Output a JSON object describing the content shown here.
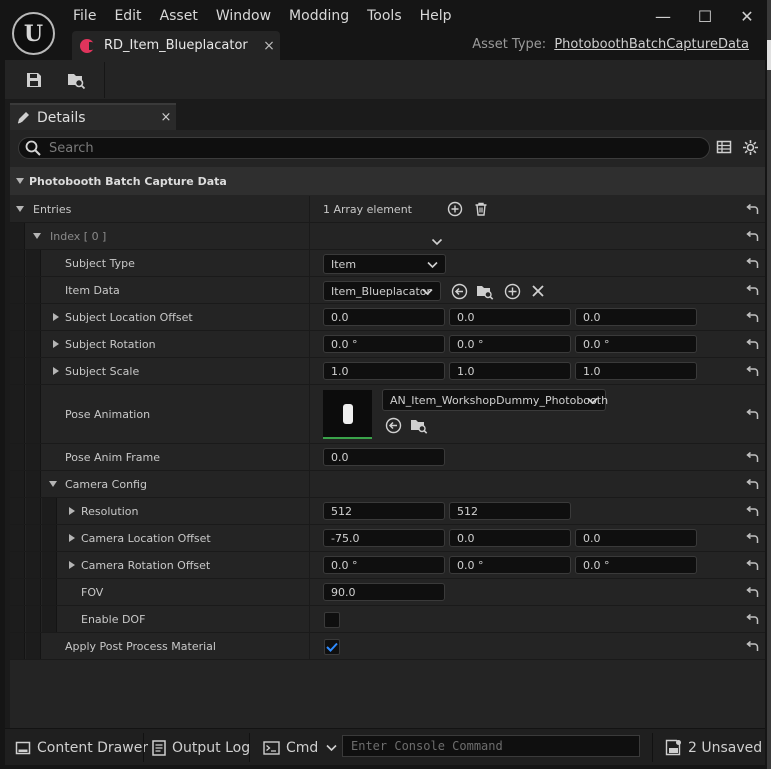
{
  "app": {
    "logo": "U"
  },
  "menu": [
    "File",
    "Edit",
    "Asset",
    "Window",
    "Modding",
    "Tools",
    "Help"
  ],
  "window_controls": {
    "minimize": "—",
    "maximize": "☐",
    "close": "✕"
  },
  "tab": {
    "name": "RD_Item_Blueplacator",
    "close": "×",
    "icon_color": "#e0345c"
  },
  "asset_type": {
    "label": "Asset Type:",
    "value": "PhotoboothBatchCaptureData"
  },
  "details": {
    "tab_label": "Details",
    "tab_close": "×",
    "search_placeholder": "Search",
    "category": "Photobooth Batch Capture Data"
  },
  "rows": {
    "entries": {
      "label": "Entries",
      "value": "1 Array element"
    },
    "index": {
      "label": "Index [ 0 ]"
    },
    "subject_type": {
      "label": "Subject Type",
      "value": "Item"
    },
    "item_data": {
      "label": "Item Data",
      "value": "Item_Blueplacator"
    },
    "subject_location_offset": {
      "label": "Subject Location Offset",
      "values": [
        "0.0",
        "0.0",
        "0.0"
      ]
    },
    "subject_rotation": {
      "label": "Subject Rotation",
      "values": [
        "0.0 °",
        "0.0 °",
        "0.0 °"
      ]
    },
    "subject_scale": {
      "label": "Subject Scale",
      "values": [
        "1.0",
        "1.0",
        "1.0"
      ]
    },
    "pose_animation": {
      "label": "Pose Animation",
      "value": "AN_Item_WorkshopDummy_Photobooth"
    },
    "pose_anim_frame": {
      "label": "Pose Anim Frame",
      "value": "0.0"
    },
    "camera_config": {
      "label": "Camera Config"
    },
    "resolution": {
      "label": "Resolution",
      "values": [
        "512",
        "512"
      ]
    },
    "camera_location_offset": {
      "label": "Camera Location Offset",
      "values": [
        "-75.0",
        "0.0",
        "0.0"
      ]
    },
    "camera_rotation_offset": {
      "label": "Camera Rotation Offset",
      "values": [
        "0.0 °",
        "0.0 °",
        "0.0 °"
      ]
    },
    "fov": {
      "label": "FOV",
      "value": "90.0"
    },
    "enable_dof": {
      "label": "Enable DOF",
      "checked": false
    },
    "apply_post_process": {
      "label": "Apply Post Process Material",
      "checked": true
    }
  },
  "statusbar": {
    "content_drawer": "Content Drawer",
    "output_log": "Output Log",
    "cmd": "Cmd",
    "console_placeholder": "Enter Console Command",
    "unsaved": "2 Unsaved"
  },
  "colors": {
    "accent_check": "#2f8cff",
    "thumb_bar": "#3aa34a"
  }
}
